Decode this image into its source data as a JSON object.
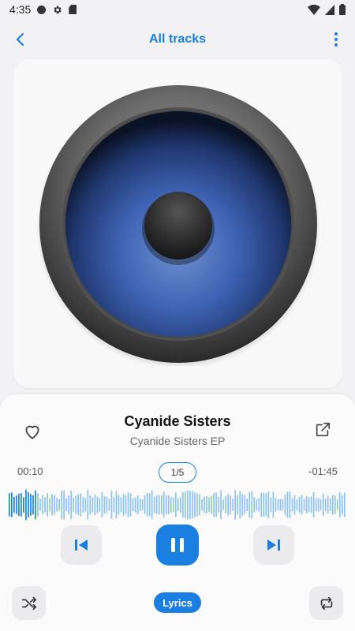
{
  "status_bar": {
    "time": "4:35"
  },
  "app_bar": {
    "title": "All tracks"
  },
  "track": {
    "title": "Cyanide Sisters",
    "album": "Cyanide Sisters EP",
    "elapsed": "00:10",
    "remaining": "-01:45",
    "queue_position": "1/5",
    "progress": 0.08
  },
  "controls": {
    "lyrics_label": "Lyrics"
  },
  "colors": {
    "accent": "#1a7fe0",
    "waveform_played": "#1a7fe0",
    "waveform_remaining": "#8cc2ee"
  }
}
